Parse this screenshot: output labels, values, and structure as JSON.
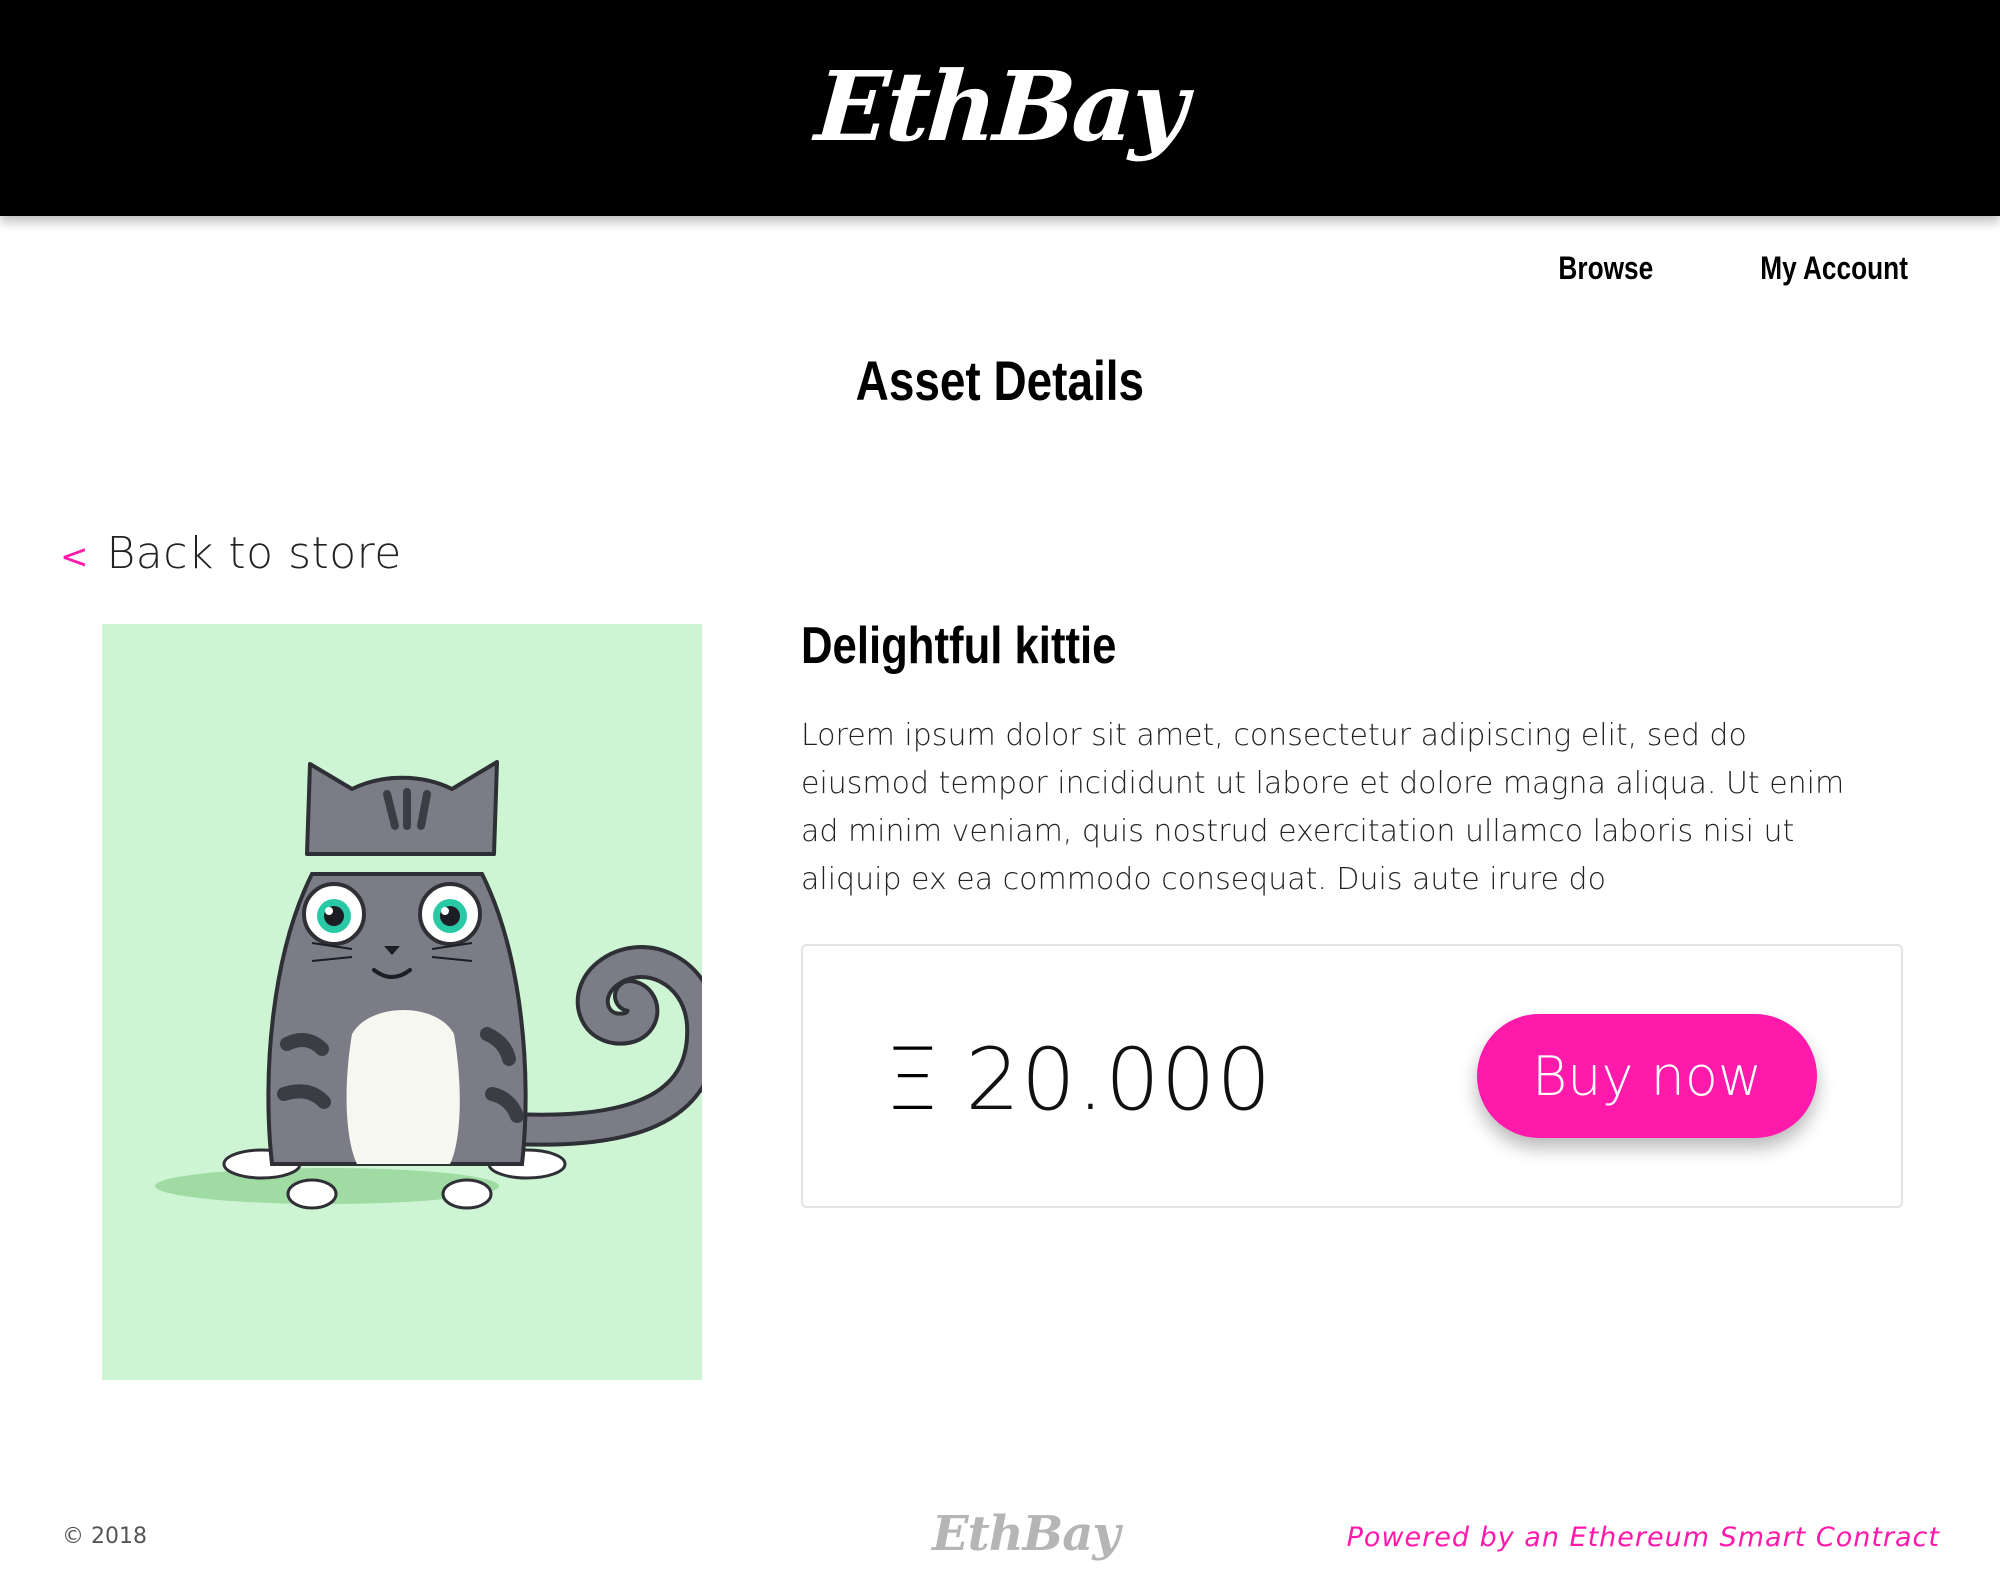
{
  "header": {
    "logo": "EthBay"
  },
  "nav": {
    "items": [
      {
        "label": "Browse"
      },
      {
        "label": "My Account"
      }
    ]
  },
  "page": {
    "title": "Asset Details"
  },
  "back_link": {
    "icon": "chevron-left-icon",
    "chevron": "<",
    "label": "Back to store"
  },
  "asset": {
    "name": "Delightful kittie",
    "description": "Lorem ipsum dolor sit amet, consectetur adipiscing elit, sed do eiusmod tempor incididunt ut labore et dolore magna aliqua. Ut enim ad minim veniam, quis nostrud exercitation ullamco laboris nisi ut aliquip ex ea commodo consequat. Duis aute irure do",
    "image_background": "#cdf5d4",
    "image_subject": "cartoon grey tabby cat illustration"
  },
  "purchase": {
    "currency_symbol": "Ξ",
    "price": "20.000",
    "button_label": "Buy now"
  },
  "footer": {
    "copyright": "© 2018",
    "logo": "EthBay",
    "powered_by": "Powered by an Ethereum Smart Contract"
  },
  "colors": {
    "accent": "#ff1aac",
    "header_bg": "#000000",
    "image_bg": "#cdf5d4"
  }
}
